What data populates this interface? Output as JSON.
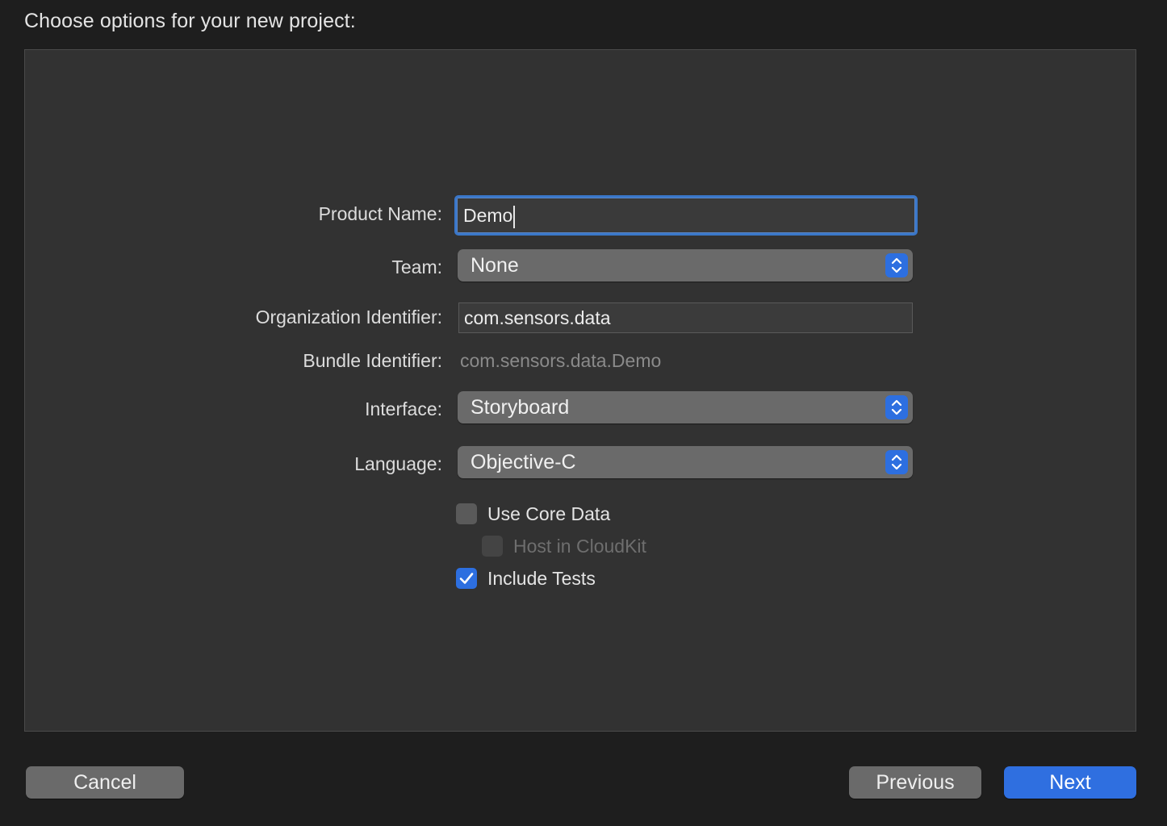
{
  "dialog": {
    "title": "Choose options for your new project:"
  },
  "form": {
    "product_name": {
      "label": "Product Name:",
      "value": "Demo"
    },
    "team": {
      "label": "Team:",
      "value": "None"
    },
    "organization_identifier": {
      "label": "Organization Identifier:",
      "value": "com.sensors.data"
    },
    "bundle_identifier": {
      "label": "Bundle Identifier:",
      "value": "com.sensors.data.Demo"
    },
    "interface": {
      "label": "Interface:",
      "value": "Storyboard"
    },
    "language": {
      "label": "Language:",
      "value": "Objective-C"
    },
    "use_core_data": {
      "label": "Use Core Data",
      "checked": false,
      "enabled": true
    },
    "host_in_cloudkit": {
      "label": "Host in CloudKit",
      "checked": false,
      "enabled": false
    },
    "include_tests": {
      "label": "Include Tests",
      "checked": true,
      "enabled": true
    }
  },
  "buttons": {
    "cancel": "Cancel",
    "previous": "Previous",
    "next": "Next"
  },
  "colors": {
    "accent": "#2f6fe0",
    "focus_ring": "#3a77c9",
    "panel": "#323232",
    "background": "#1e1e1e"
  }
}
